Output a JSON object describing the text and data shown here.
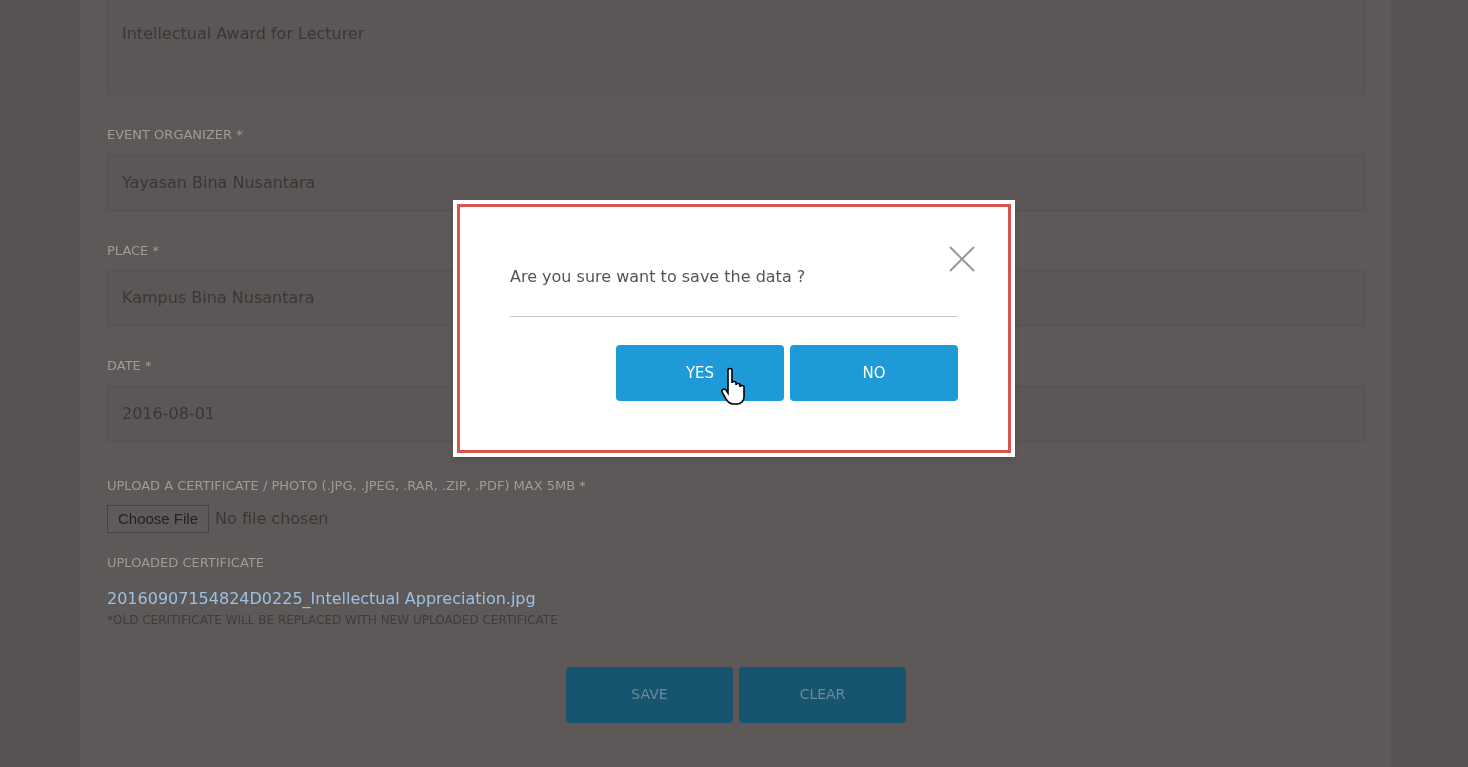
{
  "form": {
    "fields": [
      {
        "kind": "textarea",
        "value": "Intellectual Award for Lecturer"
      },
      {
        "kind": "input",
        "label": "EVENT ORGANIZER *",
        "value": "Yayasan Bina Nusantara"
      },
      {
        "kind": "input",
        "label": "PLACE *",
        "value": "Kampus Bina Nusantara"
      },
      {
        "kind": "input",
        "label": "DATE *",
        "value": "2016-08-01"
      }
    ],
    "upload": {
      "label": "UPLOAD A CERTIFICATE / PHOTO (.JPG, .JPEG, .RAR, .ZIP, .PDF) MAX 5MB *",
      "button": "Choose File",
      "status": "No file chosen"
    },
    "uploaded": {
      "label": "UPLOADED CERTIFICATE",
      "file": "20160907154824D0225_Intellectual Appreciation.jpg",
      "note": "*OLD CERITIFICATE WILL BE REPLACED WITH NEW UPLOADED CERTIFICATE"
    },
    "buttons": [
      "SAVE",
      "CLEAR"
    ]
  },
  "dialog": {
    "message": "Are you sure want to save the data ?",
    "buttons": [
      "YES",
      "NO"
    ]
  }
}
